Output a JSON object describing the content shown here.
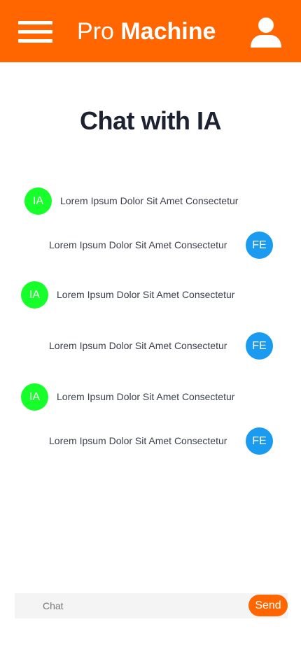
{
  "header": {
    "brand_light": "Pro ",
    "brand_bold": "Machine",
    "menu_icon": "hamburger-menu-icon",
    "profile_icon": "user-icon",
    "background": "#ff6600"
  },
  "page": {
    "title": "Chat with IA"
  },
  "messages": [
    {
      "sender": "IA",
      "text": "Lorem Ipsum Dolor Sit Amet Consectetur",
      "color": "#17ff2a"
    },
    {
      "sender": "FE",
      "text": "Lorem Ipsum Dolor Sit Amet Consectetur",
      "color": "#1a9bf0"
    },
    {
      "sender": "IA",
      "text": "Lorem Ipsum Dolor Sit Amet Consectetur",
      "color": "#17ff2a"
    },
    {
      "sender": "FE",
      "text": "Lorem Ipsum Dolor Sit Amet Consectetur",
      "color": "#1a9bf0"
    },
    {
      "sender": "IA",
      "text": "Lorem Ipsum Dolor Sit Amet Consectetur",
      "color": "#17ff2a"
    },
    {
      "sender": "FE",
      "text": "Lorem Ipsum Dolor Sit Amet Consectetur",
      "color": "#1a9bf0"
    }
  ],
  "chat": {
    "placeholder": "Chat",
    "send_label": "Send"
  }
}
